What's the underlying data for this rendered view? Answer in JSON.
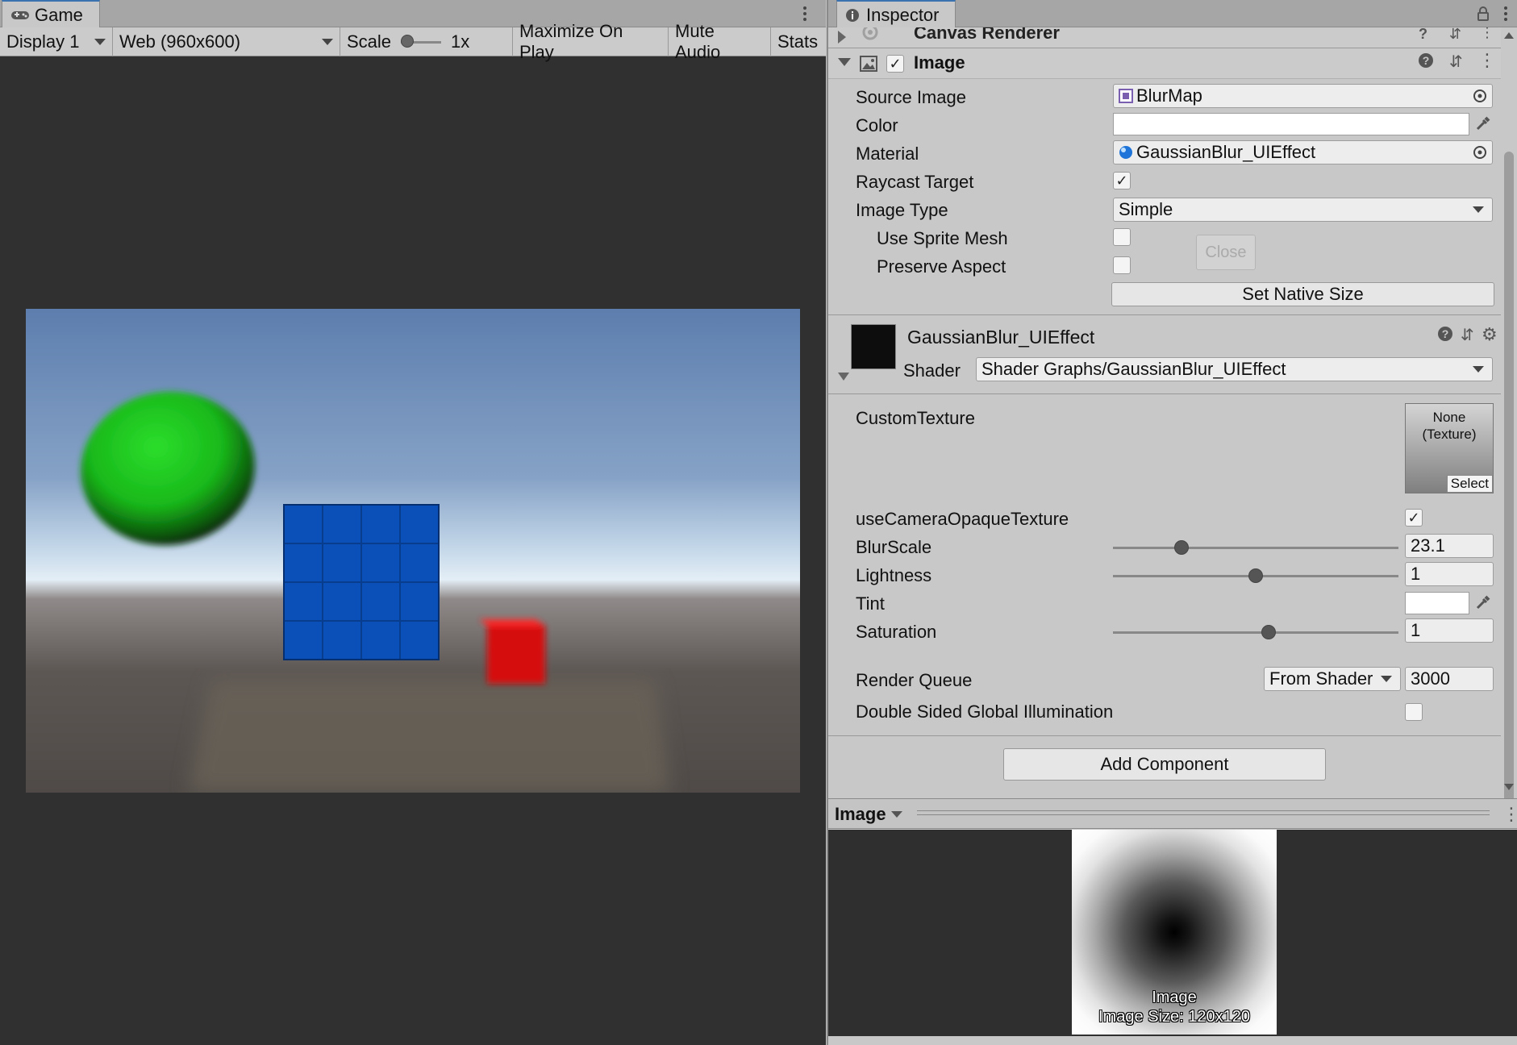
{
  "game": {
    "tab_label": "Game",
    "display": "Display 1",
    "resolution": "Web (960x600)",
    "scale_label": "Scale",
    "scale_value": "1x",
    "maximize": "Maximize On Play",
    "mute": "Mute Audio",
    "stats": "Stats"
  },
  "inspector": {
    "tab_label": "Inspector",
    "canvas_renderer_title": "Canvas Renderer",
    "image_component": {
      "title": "Image",
      "enabled": true,
      "source_image_label": "Source Image",
      "source_image_value": "BlurMap",
      "color_label": "Color",
      "color_value": "#ffffff",
      "material_label": "Material",
      "material_value": "GaussianBlur_UIEffect",
      "raycast_label": "Raycast Target",
      "raycast_checked": true,
      "image_type_label": "Image Type",
      "image_type_value": "Simple",
      "use_sprite_mesh_label": "Use Sprite Mesh",
      "preserve_aspect_label": "Preserve Aspect",
      "close_button": "Close",
      "set_native_size": "Set Native Size"
    },
    "material": {
      "name": "GaussianBlur_UIEffect",
      "shader_label": "Shader",
      "shader_value": "Shader Graphs/GaussianBlur_UIEffect",
      "custom_texture_label": "CustomTexture",
      "texture_none": "None",
      "texture_type": "(Texture)",
      "texture_select": "Select",
      "use_camera_label": "useCameraOpaqueTexture",
      "use_camera_checked": true,
      "blurscale_label": "BlurScale",
      "blurscale_value": "23.1",
      "blurscale_fraction": 0.24,
      "lightness_label": "Lightness",
      "lightness_value": "1",
      "lightness_fraction": 0.5,
      "tint_label": "Tint",
      "tint_value": "#ffffff",
      "saturation_label": "Saturation",
      "saturation_value": "1",
      "saturation_fraction": 0.545,
      "render_queue_label": "Render Queue",
      "render_queue_mode": "From Shader",
      "render_queue_value": "3000",
      "double_sided_label": "Double Sided Global Illumination"
    },
    "add_component": "Add Component",
    "preview": {
      "title": "Image",
      "caption_name": "Image",
      "caption_size": "Image Size: 120x120"
    }
  },
  "colors": {
    "sphere": "#1fc21f",
    "cube_blue": "#0b4fb8",
    "cube_red": "#d60d0d",
    "sky_top": "#5f7fae",
    "horizon": "#e3edf5",
    "ground": "#5f5956"
  }
}
